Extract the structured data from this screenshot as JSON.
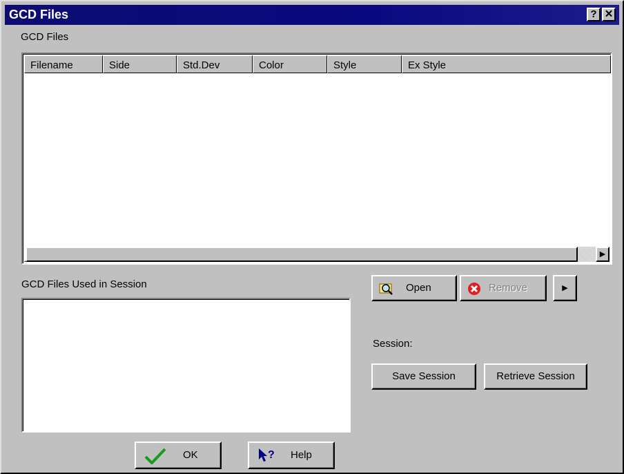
{
  "window": {
    "title": "GCD Files",
    "help_glyph": "?",
    "close_glyph": "✕"
  },
  "gcd_files": {
    "label": "GCD Files",
    "columns": [
      "Filename",
      "Side",
      "Std.Dev",
      "Color",
      "Style",
      "Ex Style"
    ],
    "rows": [],
    "scroll_left_icon": "◀",
    "scroll_right_icon": "▶"
  },
  "session_files": {
    "label": "GCD Files Used in Session",
    "items": []
  },
  "buttons": {
    "open": "Open",
    "remove": "Remove",
    "more": "▶",
    "save_session": "Save Session",
    "retrieve_session": "Retrieve Session",
    "ok": "OK",
    "help": "Help"
  },
  "session_label": "Session:",
  "icons": {
    "open": "open-file-magnifier-icon",
    "remove": "remove-x-icon",
    "ok": "checkmark-icon",
    "help": "whats-this-help-icon"
  },
  "colors": {
    "title_bar": "#0c0c72",
    "dialog_face": "#c0c0c0",
    "remove_icon": "#e02020",
    "ok_check": "#1a9a1a",
    "help_icon": "#000080"
  }
}
